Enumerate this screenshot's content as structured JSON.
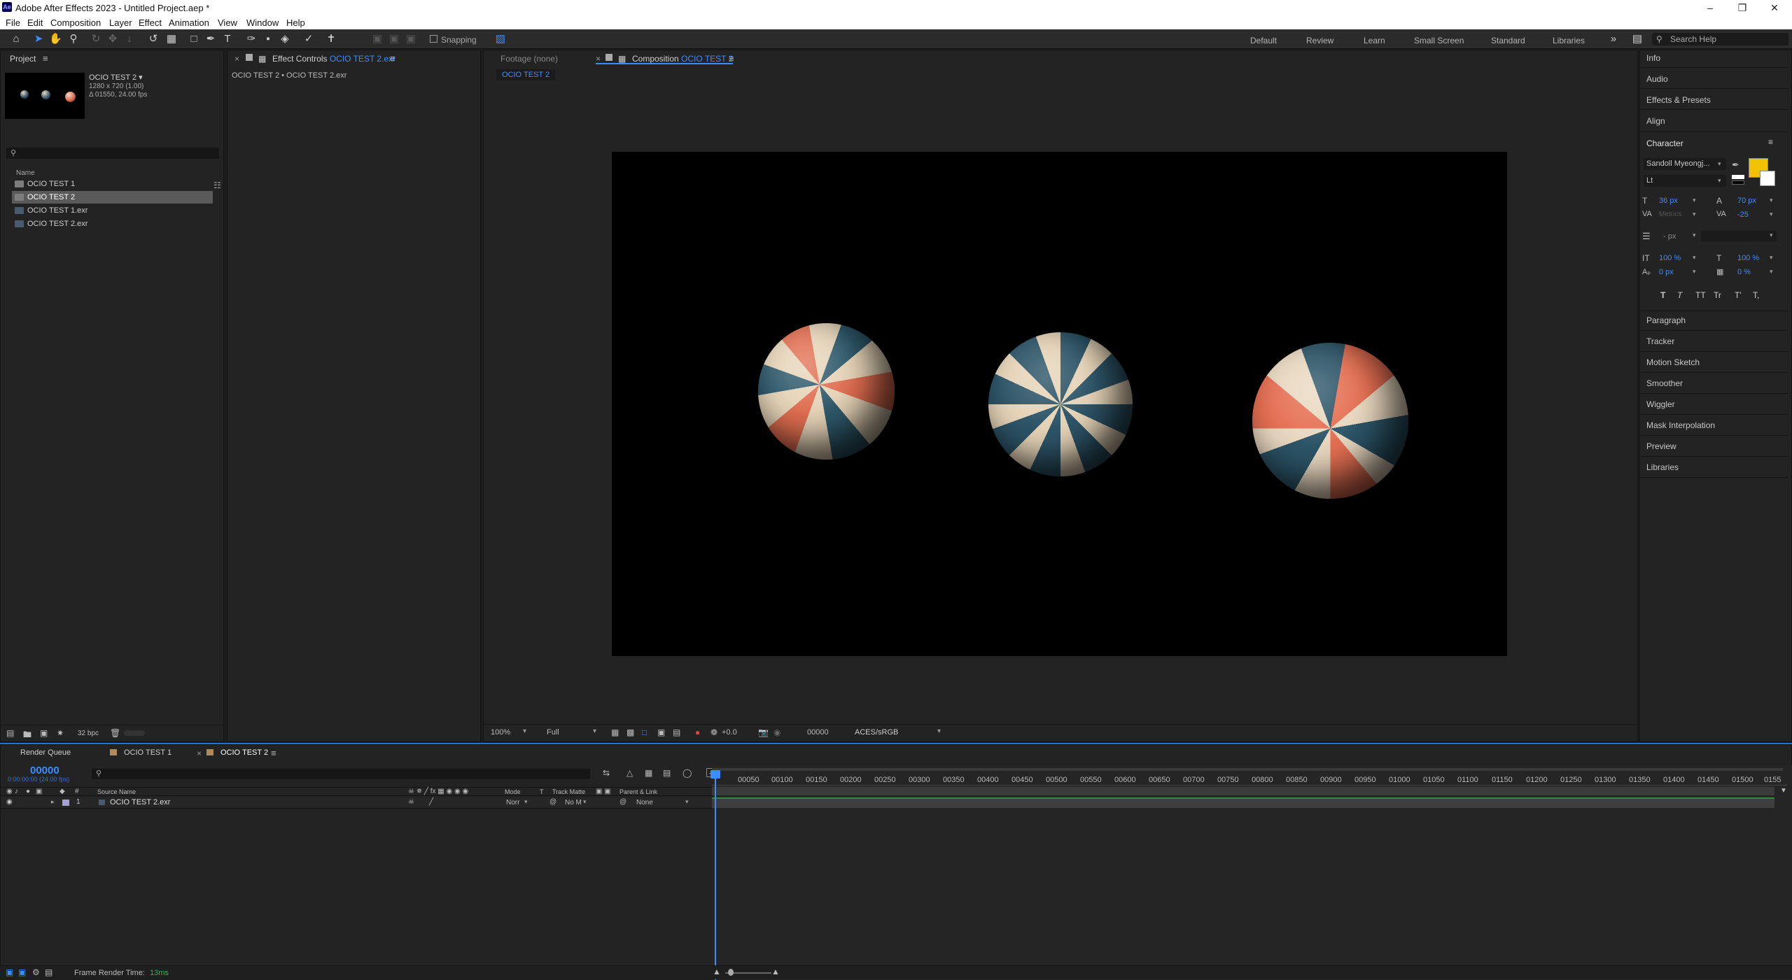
{
  "window": {
    "title": "Adobe After Effects 2023 - Untitled Project.aep *",
    "app_icon": "Ae",
    "controls": [
      "minimize-icon",
      "maximize-icon",
      "close-icon"
    ]
  },
  "menu": [
    "File",
    "Edit",
    "Composition",
    "Layer",
    "Effect",
    "Animation",
    "View",
    "Window",
    "Help"
  ],
  "toolbar": {
    "snapping_label": "Snapping",
    "workspaces": [
      "Default",
      "Review",
      "Learn",
      "Small Screen",
      "Standard",
      "Libraries"
    ],
    "search_placeholder": "Search Help"
  },
  "project": {
    "tab_label": "Project",
    "selected_name": "OCIO TEST 2 ▾",
    "selected_info1": "1280 x 720 (1.00)",
    "selected_info2": "Δ 01550, 24.00 fps",
    "column_name": "Name",
    "items": [
      {
        "name": "OCIO TEST 1",
        "type": "comp"
      },
      {
        "name": "OCIO TEST 2",
        "type": "comp"
      },
      {
        "name": "OCIO TEST 1.exr",
        "type": "footage"
      },
      {
        "name": "OCIO TEST 2.exr",
        "type": "footage"
      }
    ],
    "bpc_label": "32 bpc"
  },
  "effect_controls": {
    "tab_prefix": "Effect Controls",
    "tab_target": "OCIO TEST 2.exr",
    "breadcrumb": "OCIO TEST 2 • OCIO TEST 2.exr"
  },
  "viewer": {
    "footage_tab": "Footage (none)",
    "comp_tab_prefix": "Composition",
    "comp_tab_target": "OCIO TEST 2",
    "comp_chip": "OCIO TEST 2",
    "zoom": "100%",
    "resolution": "Full",
    "exposure": "+0.0",
    "timecode": "00000",
    "color_space": "ACES/sRGB"
  },
  "right_panels": {
    "top": [
      "Info",
      "Audio",
      "Effects & Presets",
      "Align"
    ],
    "character_label": "Character",
    "font_family": "Sandoll Myeongj...",
    "font_style": "Lt",
    "font_size": "36 px",
    "leading": "70 px",
    "kerning": "Metrics",
    "tracking": "-25",
    "stroke_width": "- px",
    "vert_scale": "100 %",
    "horiz_scale": "100 %",
    "baseline": "0 px",
    "tsume": "0 %",
    "fill_color": "#f2c200",
    "style_buttons": [
      "T",
      "T",
      "TT",
      "Tr",
      "T'",
      "T,"
    ],
    "bottom": [
      "Paragraph",
      "Tracker",
      "Motion Sketch",
      "Smoother",
      "Wiggler",
      "Mask Interpolation",
      "Preview",
      "Libraries"
    ]
  },
  "timeline": {
    "tabs": [
      "Render Queue",
      "OCIO TEST 1",
      "OCIO TEST 2"
    ],
    "timecode": "00000",
    "timecode_sub": "0:00:00:00 (24.00 fps)",
    "columns": {
      "source": "Source Name",
      "mode": "Mode",
      "t": "T",
      "track_matte": "Track Matte",
      "parent": "Parent & Link"
    },
    "layer": {
      "index": "1",
      "name": "OCIO TEST 2.exr",
      "mode": "Norr",
      "matte": "No M",
      "parent": "None"
    },
    "ruler": [
      "00050",
      "00100",
      "00150",
      "00200",
      "00250",
      "00300",
      "00350",
      "00400",
      "00450",
      "00500",
      "00550",
      "00600",
      "00650",
      "00700",
      "00750",
      "00800",
      "00850",
      "00900",
      "00950",
      "01000",
      "01050",
      "01100",
      "01150",
      "01200",
      "01250",
      "01300",
      "01350",
      "01400",
      "01450",
      "01500",
      "0155"
    ],
    "render_label": "Frame Render Time:",
    "render_value": "13ms"
  }
}
